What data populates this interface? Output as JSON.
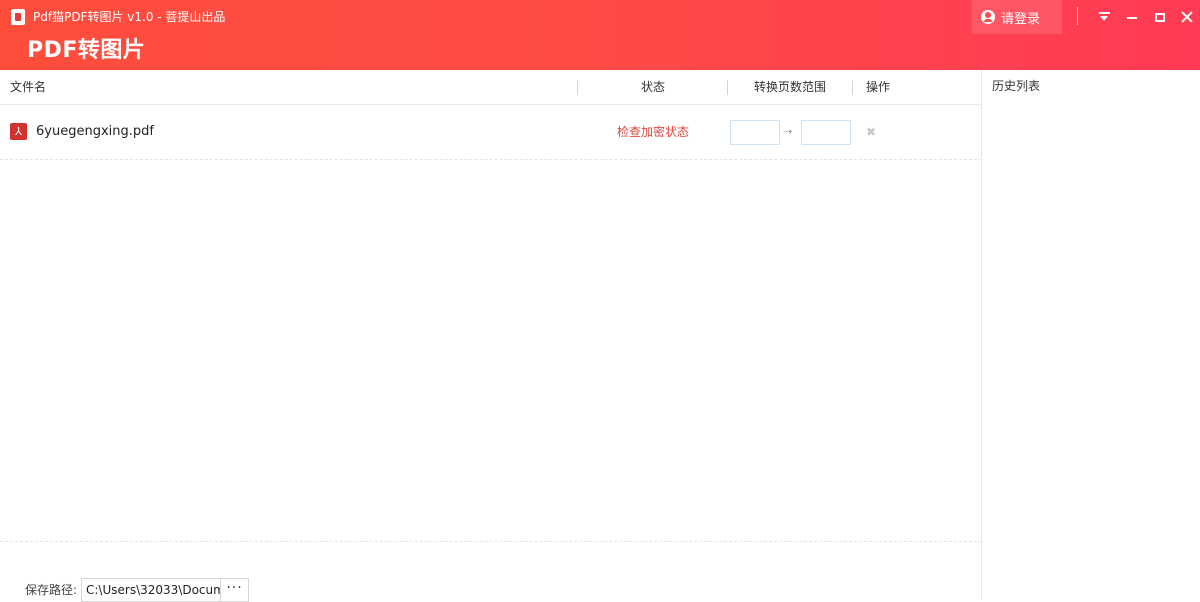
{
  "titlebar": {
    "window_title": "Pdf猫PDF转图片 v1.0 - 菩提山出品",
    "heading": "PDF转图片",
    "login_label": "请登录",
    "icons": {
      "app": "pdf-app-icon",
      "user": "user-icon",
      "menu": "dropdown-menu-icon",
      "minimize": "minimize-icon",
      "maximize": "maximize-icon",
      "close": "close-icon"
    }
  },
  "table": {
    "columns": [
      "文件名",
      "状态",
      "转换页数范围",
      "操作"
    ],
    "rows": [
      {
        "file_name": "6yuegengxing.pdf",
        "status": "检查加密状态",
        "range_start": "",
        "range_end": "",
        "range_arrow": "⇢",
        "delete_glyph": "✖"
      }
    ]
  },
  "save": {
    "label": "保存路径:",
    "path": "C:\\Users\\32033\\Docum",
    "browse_label": "···"
  },
  "history": {
    "title": "历史列表"
  },
  "colors": {
    "titlebar_start": "#ff4d3c",
    "titlebar_end": "#ff3b55",
    "status_red": "#e2483d",
    "pdf_red": "#d2322d"
  }
}
